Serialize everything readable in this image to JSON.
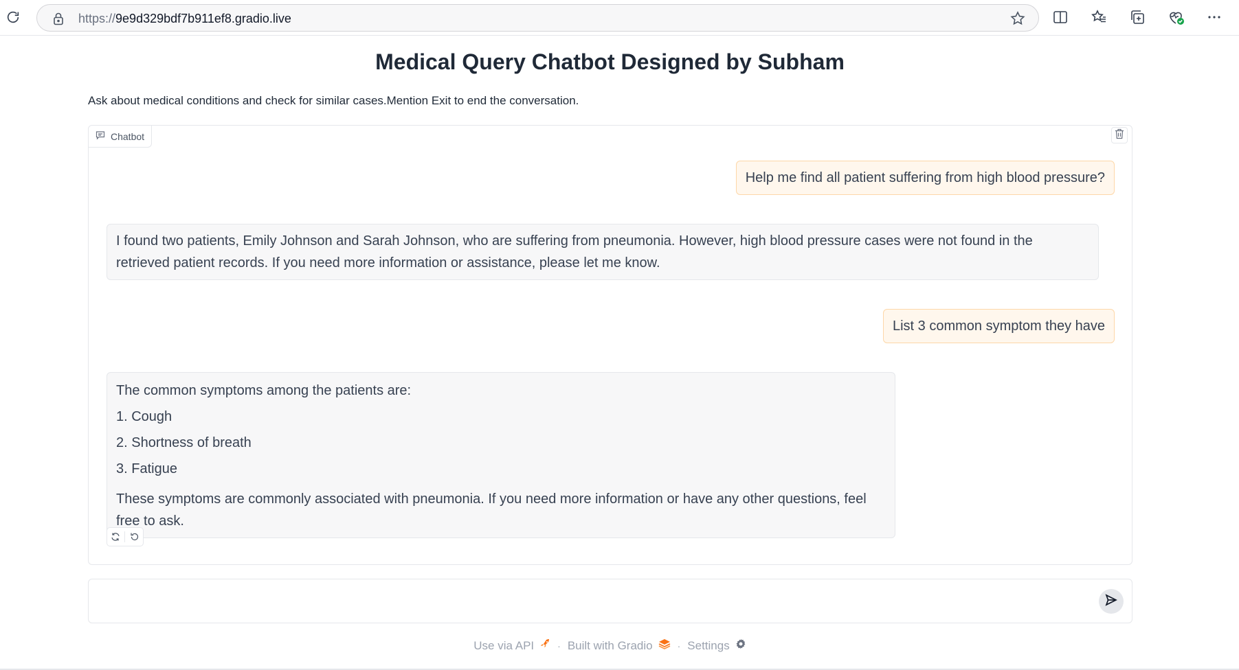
{
  "browser": {
    "url_scheme": "https://",
    "url_host": "9e9d329bdf7b911ef8.gradio.live"
  },
  "page": {
    "title": "Medical Query Chatbot Designed by Subham",
    "description": "Ask about medical conditions and check for similar cases.Mention Exit to end the conversation."
  },
  "chatbot": {
    "label": "Chatbot",
    "messages": [
      {
        "role": "user",
        "text": "Help me find all patient suffering from high blood pressure?"
      },
      {
        "role": "bot",
        "text": "I found two patients, Emily Johnson and Sarah Johnson, who are suffering from pneumonia. However, high blood pressure cases were not found in the retrieved patient records. If you need more information or assistance, please let me know."
      },
      {
        "role": "user",
        "text": "List 3 common symptom they have"
      },
      {
        "role": "bot",
        "lines": [
          "The common symptoms among the patients are:",
          "1. Cough",
          "2. Shortness of breath",
          "3. Fatigue",
          "These symptoms are commonly associated with pneumonia. If you need more information or have any other questions, feel free to ask."
        ]
      }
    ]
  },
  "input": {
    "value": "",
    "placeholder": ""
  },
  "footer": {
    "api_label": "Use via API",
    "built_label": "Built with Gradio",
    "settings_label": "Settings",
    "separator": "·"
  },
  "colors": {
    "user_bubble_bg": "#fff7ed",
    "user_bubble_border": "#fdd7a8",
    "bot_bubble_bg": "#f7f7f8",
    "gradio_orange": "#f97316"
  }
}
